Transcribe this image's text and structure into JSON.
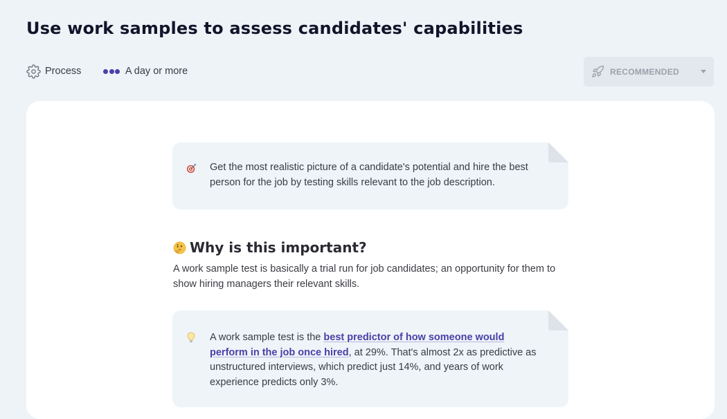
{
  "header": {
    "title": "Use work samples to assess candidates' capabilities",
    "category": {
      "icon": "gear-icon",
      "label": "Process"
    },
    "duration": {
      "icon": "dots-icon",
      "label": "A day or more",
      "dots_color": "#4840a8"
    },
    "status_dropdown": {
      "icon": "rocket-icon",
      "label": "RECOMMENDED",
      "caret_icon": "chevron-down-icon"
    }
  },
  "content": {
    "intro_callout": {
      "icon": "target-icon",
      "text": "Get the most realistic picture of a candidate's potential and hire the best person for the job by testing skills relevant to the job description."
    },
    "section": {
      "heading_icon": "thinking-face-icon",
      "heading": "Why is this important?",
      "body": "A work sample test is basically a trial run for job candidates; an opportunity for them to show hiring managers their relevant skills."
    },
    "tip_callout": {
      "icon": "lightbulb-icon",
      "text_before": "A work sample test is the ",
      "link_text": "best predictor of how someone would perform in the job once hired",
      "text_after": ", at 29%. That's almost 2x as predictive as unstructured interviews, which predict just 14%, and years of work experience predicts only 3%."
    }
  },
  "colors": {
    "page_background": "#eef3f7",
    "card_background": "#ffffff",
    "callout_background": "#eff4f8",
    "accent": "#4840a8",
    "title": "#13132b",
    "muted": "#9aa1aa"
  }
}
